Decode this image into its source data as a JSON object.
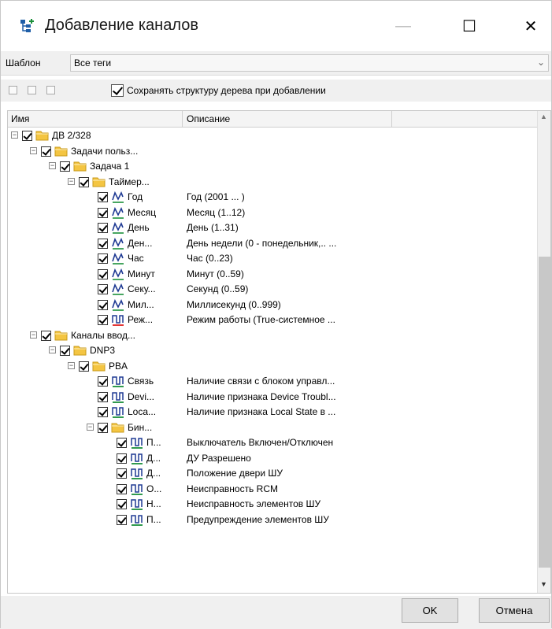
{
  "window": {
    "title": "Добавление каналов",
    "minimize_glyph": "—",
    "maximize_glyph": "☐",
    "close_glyph": "✕"
  },
  "template": {
    "label": "Шаблон",
    "value": "Все теги",
    "arrow": "⌄"
  },
  "toolbar": {
    "keep_structure_label": "Сохранять структуру дерева при добавлении",
    "keep_structure_checked": true
  },
  "tree": {
    "columns": [
      "Имя",
      "Описание"
    ],
    "rows": [
      {
        "level": 0,
        "kind": "folder",
        "expanded": true,
        "name": "ДВ 2/328",
        "desc": ""
      },
      {
        "level": 1,
        "kind": "folder",
        "expanded": true,
        "name": "Задачи польз...",
        "desc": ""
      },
      {
        "level": 2,
        "kind": "folder",
        "expanded": true,
        "name": "Задача 1",
        "desc": ""
      },
      {
        "level": 3,
        "kind": "folder",
        "expanded": true,
        "name": "Таймер...",
        "desc": ""
      },
      {
        "level": 4,
        "kind": "analog",
        "name": "Год",
        "desc": "Год (2001 ... )"
      },
      {
        "level": 4,
        "kind": "analog",
        "name": "Месяц",
        "desc": "Месяц (1..12)"
      },
      {
        "level": 4,
        "kind": "analog",
        "name": "День",
        "desc": "День (1..31)"
      },
      {
        "level": 4,
        "kind": "analog",
        "name": "Ден...",
        "desc": "День недели (0 - понедельник,.. ..."
      },
      {
        "level": 4,
        "kind": "analog",
        "name": "Час",
        "desc": "Час (0..23)"
      },
      {
        "level": 4,
        "kind": "analog",
        "name": "Минут",
        "desc": "Минут (0..59)"
      },
      {
        "level": 4,
        "kind": "analog",
        "name": "Секу...",
        "desc": "Секунд (0..59)"
      },
      {
        "level": 4,
        "kind": "analog",
        "name": "Мил...",
        "desc": "Миллисекунд (0..999)"
      },
      {
        "level": 4,
        "kind": "discrete-red",
        "name": "Реж...",
        "desc": "Режим работы (True-системное ..."
      },
      {
        "level": 1,
        "kind": "folder",
        "expanded": true,
        "name": "Каналы ввод...",
        "desc": ""
      },
      {
        "level": 2,
        "kind": "folder",
        "expanded": true,
        "name": "DNP3",
        "desc": ""
      },
      {
        "level": 3,
        "kind": "folder",
        "expanded": true,
        "name": "PBA",
        "desc": ""
      },
      {
        "level": 4,
        "kind": "discrete",
        "name": "Связь",
        "desc": "Наличие связи с блоком управл..."
      },
      {
        "level": 4,
        "kind": "discrete",
        "name": "Devi...",
        "desc": "Наличие признака Device Troubl..."
      },
      {
        "level": 4,
        "kind": "discrete",
        "name": "Loca...",
        "desc": "Наличие признака Local State в ..."
      },
      {
        "level": 4,
        "kind": "folder",
        "expanded": true,
        "name": "Бин...",
        "desc": ""
      },
      {
        "level": 5,
        "kind": "discrete",
        "name": "П...",
        "desc": "Выключатель Включен/Отключен"
      },
      {
        "level": 5,
        "kind": "discrete",
        "name": "Д...",
        "desc": "ДУ Разрешено"
      },
      {
        "level": 5,
        "kind": "discrete",
        "name": "Д...",
        "desc": "Положение двери ШУ"
      },
      {
        "level": 5,
        "kind": "discrete",
        "name": "О...",
        "desc": "Неисправность RCM"
      },
      {
        "level": 5,
        "kind": "discrete",
        "name": "Н...",
        "desc": "Неисправность элементов ШУ"
      },
      {
        "level": 5,
        "kind": "discrete",
        "name": "П...",
        "desc": "Предупреждение элементов ШУ"
      }
    ]
  },
  "buttons": {
    "ok": "OK",
    "cancel": "Отмена"
  },
  "colors": {
    "folder": "#f4c542",
    "folder_edge": "#c89a1a",
    "wave": "#1f3a93",
    "wave_green": "#1a8f3a",
    "red": "#e02020"
  }
}
